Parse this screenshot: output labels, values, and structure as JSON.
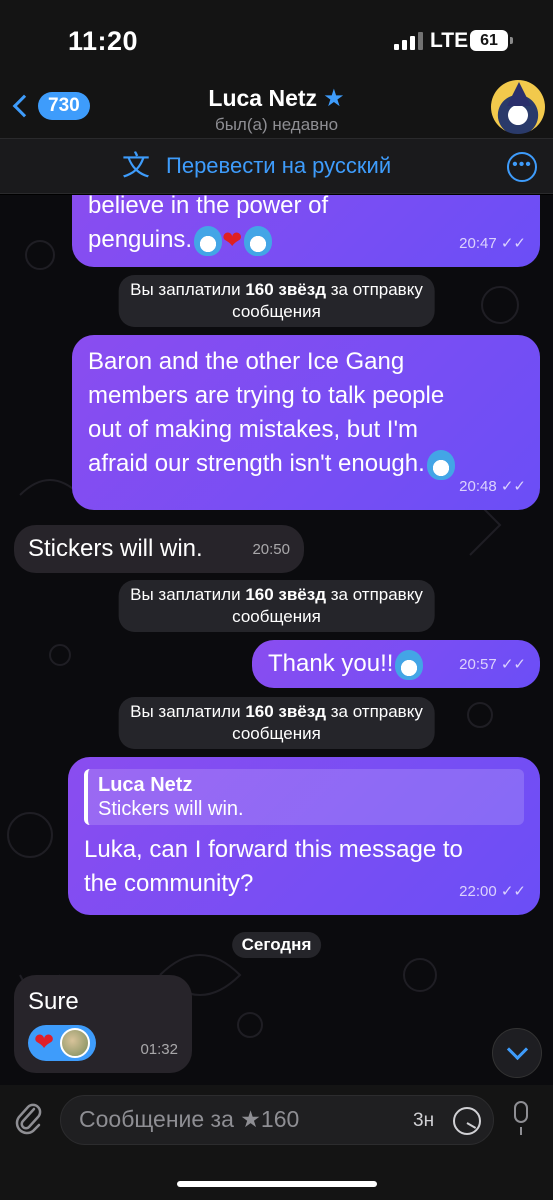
{
  "status": {
    "time": "11:20",
    "network": "LTE",
    "battery": "61"
  },
  "header": {
    "back_count": "730",
    "name": "Luca Netz",
    "status": "был(а) недавно"
  },
  "translate": {
    "label": "Перевести на русский",
    "icon": "translate-icon"
  },
  "messages": [
    {
      "dir": "out",
      "text_l1": "believe in the power of",
      "text_l2": "penguins.",
      "time": "20:47"
    },
    {
      "dir": "service",
      "pre": "Вы заплатили ",
      "bold": "160 звёзд",
      "post": " за отправку",
      "l2": "сообщения"
    },
    {
      "dir": "out",
      "l1": "Baron and the other Ice Gang",
      "l2": "members are trying to talk people",
      "l3": "out of making mistakes, but I'm",
      "l4": "afraid our strength isn't enough.",
      "time": "20:48"
    },
    {
      "dir": "in",
      "text": "Stickers will win.",
      "time": "20:50"
    },
    {
      "dir": "service",
      "pre": "Вы заплатили ",
      "bold": "160 звёзд",
      "post": " за отправку",
      "l2": "сообщения"
    },
    {
      "dir": "out",
      "text": "Thank you!!",
      "time": "20:57"
    },
    {
      "dir": "service",
      "pre": "Вы заплатили ",
      "bold": "160 звёзд",
      "post": " за отправку",
      "l2": "сообщения"
    },
    {
      "dir": "out",
      "reply_name": "Luca Netz",
      "reply_text": "Stickers will win.",
      "l1": "Luka, can I forward this message to",
      "l2": "the community?",
      "time": "22:00"
    },
    {
      "dir": "date",
      "text": "Сегодня"
    },
    {
      "dir": "in",
      "text": "Sure",
      "time": "01:32",
      "reaction": "heart"
    }
  ],
  "composer": {
    "placeholder": "Сообщение за ★160",
    "timer": "3н"
  },
  "colors": {
    "accent": "#3e9cfb",
    "bubble_out": "#7a4ef3",
    "bubble_in": "#27242a"
  }
}
